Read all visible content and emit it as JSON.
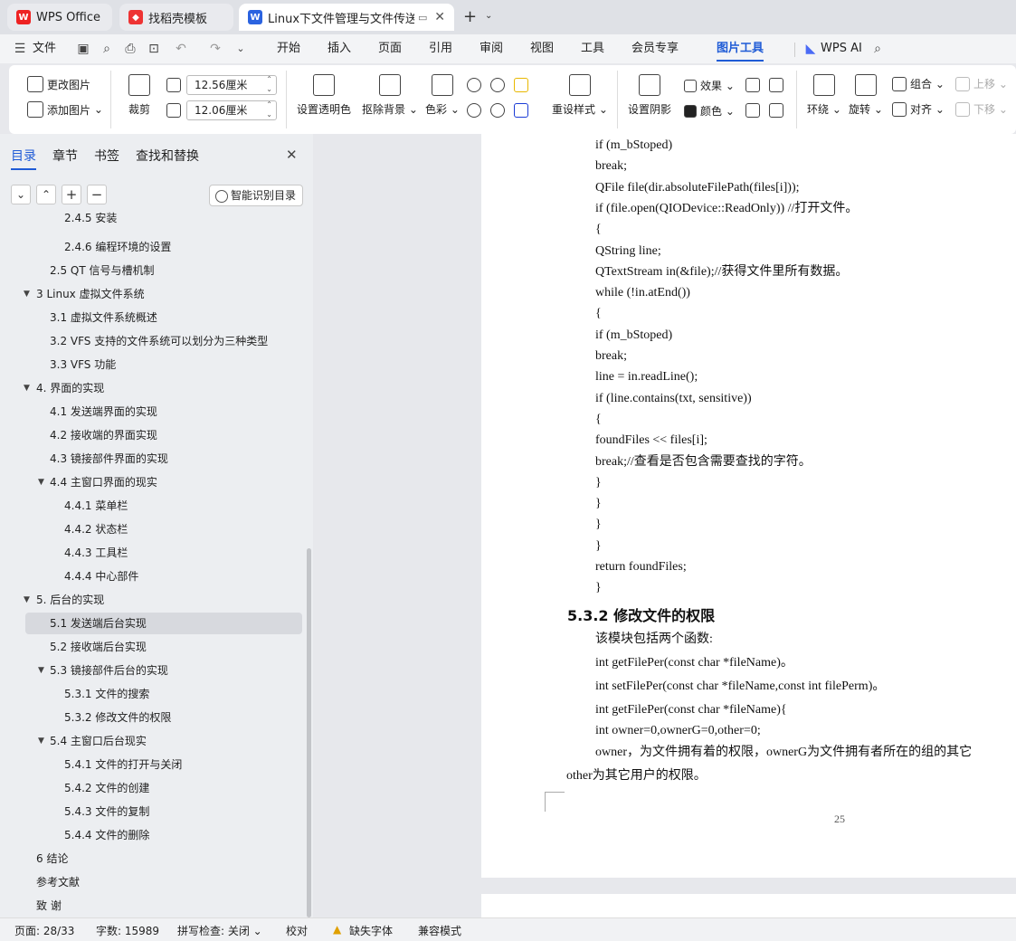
{
  "tabs": [
    {
      "label": "WPS Office",
      "icon": "wps-logo-icon"
    },
    {
      "label": "找稻壳模板",
      "icon": "docer-icon"
    },
    {
      "label": "Linux下文件管理与文件传送的",
      "icon": "writer-doc-icon"
    }
  ],
  "menu": {
    "file": "文件",
    "items": [
      "开始",
      "插入",
      "页面",
      "引用",
      "审阅",
      "视图",
      "工具",
      "会员专享",
      "图片工具"
    ],
    "wps_ai": "WPS AI"
  },
  "ribbon": {
    "change_picture": "更改图片",
    "add_picture": "添加图片",
    "crop": "裁剪",
    "width_value": "12.56厘米",
    "height_value": "12.06厘米",
    "set_transparent": "设置透明色",
    "remove_background": "抠除背景",
    "color": "色彩",
    "reset_style": "重设样式",
    "set_shadow": "设置阴影",
    "effects": "效果",
    "colors": "颜色",
    "wrap": "环绕",
    "rotate": "旋转",
    "group": "组合",
    "align": "对齐",
    "move_up": "上移",
    "move_down": "下移"
  },
  "nav": {
    "tabs": [
      "目录",
      "章节",
      "书签",
      "查找和替换"
    ],
    "smart_toc": "智能识别目录",
    "items": [
      {
        "label": "2.4.5 安装",
        "level": 3
      },
      {
        "label": "2.4.6  编程环境的设置",
        "level": 3
      },
      {
        "label": "2.5  QT 信号与槽机制",
        "level": 2
      },
      {
        "label": "3  Linux 虚拟文件系统",
        "level": 1,
        "expanded": true
      },
      {
        "label": "3.1 虚拟文件系统概述",
        "level": 2
      },
      {
        "label": "3.2  VFS 支持的文件系统可以划分为三种类型",
        "level": 2
      },
      {
        "label": "3.3 VFS 功能",
        "level": 2
      },
      {
        "label": "4.  界面的实现",
        "level": 1,
        "expanded": true
      },
      {
        "label": "4.1 发送端界面的实现",
        "level": 2
      },
      {
        "label": "4.2 接收端的界面实现",
        "level": 2
      },
      {
        "label": "4.3 镜接部件界面的实现",
        "level": 2
      },
      {
        "label": "4.4 主窗口界面的现实",
        "level": 2,
        "expanded": true
      },
      {
        "label": "4.4.1 菜单栏",
        "level": 3
      },
      {
        "label": "4.4.2 状态栏",
        "level": 3
      },
      {
        "label": "4.4.3 工具栏",
        "level": 3
      },
      {
        "label": "4.4.4 中心部件",
        "level": 3
      },
      {
        "label": "5. 后台的实现",
        "level": 1,
        "expanded": true
      },
      {
        "label": "5.1 发送端后台实现",
        "level": 2,
        "selected": true
      },
      {
        "label": "5.2 接收端后台实现",
        "level": 2
      },
      {
        "label": "5.3 镜接部件后台的实现",
        "level": 2,
        "expanded": true
      },
      {
        "label": "5.3.1 文件的搜索",
        "level": 3
      },
      {
        "label": "5.3.2  修改文件的权限",
        "level": 3
      },
      {
        "label": "5.4 主窗口后台现实",
        "level": 2,
        "expanded": true
      },
      {
        "label": "5.4.1 文件的打开与关闭",
        "level": 3
      },
      {
        "label": "5.4.2 文件的创建",
        "level": 3
      },
      {
        "label": "5.4.3 文件的复制",
        "level": 3
      },
      {
        "label": "5.4.4 文件的删除",
        "level": 3
      },
      {
        "label": "6  结论",
        "level": 1
      },
      {
        "label": "参考文献",
        "level": 1
      },
      {
        "label": "致  谢",
        "level": 1
      }
    ]
  },
  "document": {
    "code_lines_1": [
      "if (m_bStoped)",
      "break;",
      "QFile file(dir.absoluteFilePath(files[i]));",
      "if (file.open(QIODevice::ReadOnly)) //打开文件。",
      "{",
      "QString line;",
      "QTextStream in(&file);//获得文件里所有数据。",
      "while (!in.atEnd())",
      "{",
      "if (m_bStoped)",
      "break;",
      "line = in.readLine();",
      "if (line.contains(txt, sensitive))",
      "{",
      "foundFiles << files[i];",
      "break;//查看是否包含需要查找的字符。",
      "}",
      "}",
      "}",
      "}",
      "return foundFiles;",
      "}"
    ],
    "heading": "5.3.2  修改文件的权限",
    "body_lines": [
      "该模块包括两个函数:",
      "int getFilePer(const char *fileName)。",
      "int setFilePer(const char *fileName,const int filePerm)。",
      "int getFilePer(const char *fileName){",
      "int owner=0,ownerG=0,other=0;",
      "owner，为文件拥有着的权限，ownerG为文件拥有者所在的组的其它"
    ],
    "last_line": "other为其它用户的权限。",
    "page_number": "25"
  },
  "status": {
    "page": "页面: 28/33",
    "words": "字数: 15989",
    "spell": "拼写检查: 关闭",
    "proof": "校对",
    "missing_font": "缺失字体",
    "compat": "兼容模式"
  }
}
